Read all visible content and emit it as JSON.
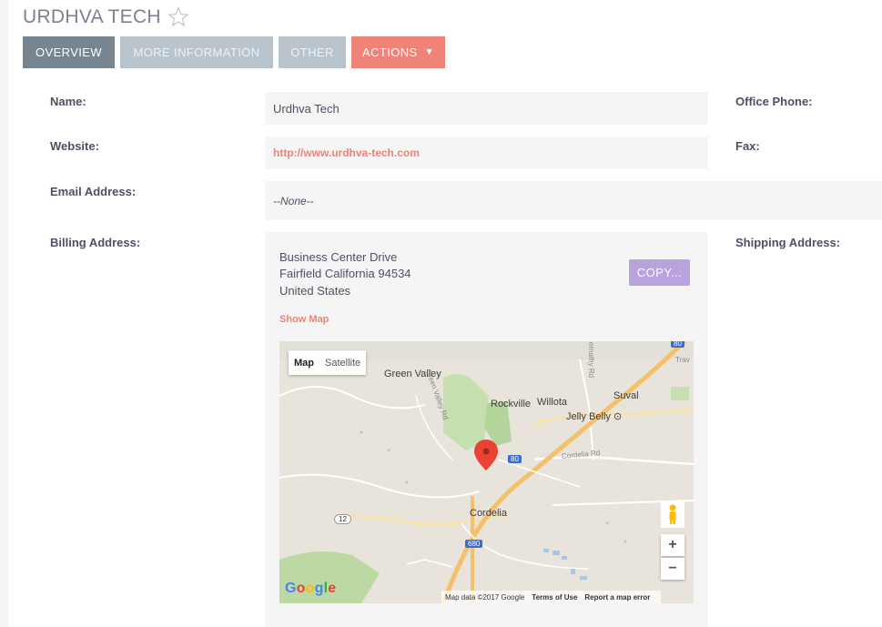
{
  "header": {
    "title": "URDHVA TECH"
  },
  "tabs": [
    {
      "label": "OVERVIEW"
    },
    {
      "label": "MORE INFORMATION"
    },
    {
      "label": "OTHER"
    },
    {
      "label": "ACTIONS"
    }
  ],
  "fields": {
    "name_label": "Name:",
    "name_value": "Urdhva Tech",
    "website_label": "Website:",
    "website_value": "http://www.urdhva-tech.com",
    "email_label": "Email Address:",
    "email_value": "--None--",
    "billing_label": "Billing Address:",
    "office_phone_label": "Office Phone:",
    "fax_label": "Fax:",
    "shipping_label": "Shipping Address:"
  },
  "billing_address": {
    "street": "Business Center Drive",
    "city_line": "Fairfield California  94534",
    "country": "United States",
    "copy_label": "COPY...",
    "show_map_label": "Show Map"
  },
  "map": {
    "type_map": "Map",
    "type_satellite": "Satellite",
    "places": {
      "green_valley": "Green Valley",
      "rockville": "Rockville",
      "willota": "Willota",
      "suval": "Suval",
      "jelly_belly": "Jelly Belly",
      "cordelia": "Cordelia",
      "cordelia_rd": "Cordelia Rd",
      "green_valley_rd": "Green Valley Rd",
      "abernathy_rd": "ernathy Rd",
      "trav": "Trav"
    },
    "shields": {
      "i80": "80",
      "i680": "680",
      "r12": "12",
      "i80_top": "80"
    },
    "zoom_in": "+",
    "zoom_out": "−",
    "google": "Google",
    "attribution": "Map data ©2017 Google",
    "terms": "Terms of Use",
    "report": "Report a map error"
  },
  "colors": {
    "tab_active": "#778591",
    "tab_inactive": "#b9c4cd",
    "tab_actions": "#f08377",
    "copy_button": "#b8a3df",
    "link": "#f08377",
    "label_text": "#534d64"
  }
}
